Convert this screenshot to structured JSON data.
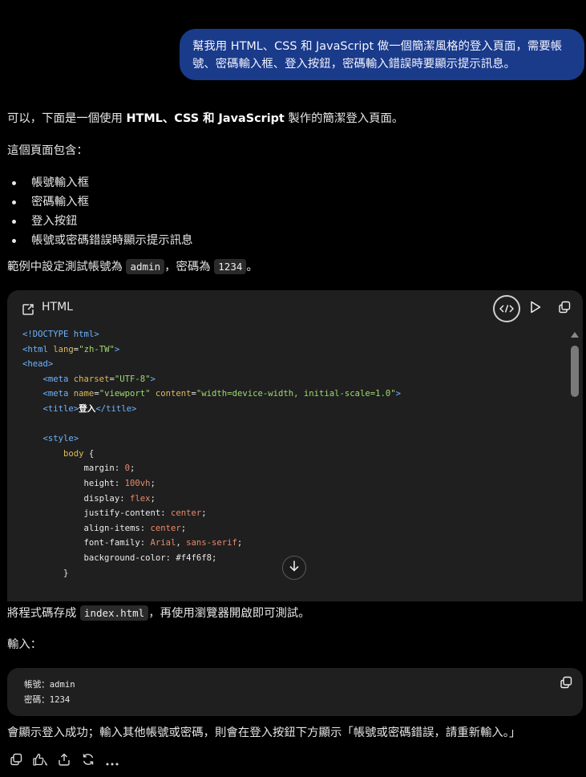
{
  "user_message": "幫我用 HTML、CSS 和 JavaScript 做一個簡潔風格的登入頁面，需要帳號、密碼輸入框、登入按鈕，密碼輸入錯誤時要顯示提示訊息。",
  "response": {
    "intro_prefix": "可以，下面是一個使用 ",
    "intro_bold": "HTML、CSS 和 JavaScript",
    "intro_suffix": " 製作的簡潔登入頁面。",
    "contains_label": "這個頁面包含：",
    "bullets": [
      "帳號輸入框",
      "密碼輸入框",
      "登入按鈕",
      "帳號或密碼錯誤時顯示提示訊息"
    ],
    "test_prefix": "範例中設定測試帳號為 ",
    "test_account": "admin",
    "test_mid": "，密碼為 ",
    "test_password": "1234",
    "test_suffix": "。",
    "save_prefix": "將程式碼存成 ",
    "save_file": "index.html",
    "save_suffix": "，再使用瀏覽器開啟即可測試。",
    "input_label": "輸入：",
    "input_account_label": "帳號：",
    "input_account": "admin",
    "input_password_label": "密碼：",
    "input_password": "1234",
    "result_text": "會顯示登入成功；輸入其他帳號或密碼，則會在登入按鈕下方顯示「帳號或密碼錯誤，請重新輸入。」"
  },
  "code_block": {
    "language": "HTML",
    "icons": {
      "lang": "edit-code-icon",
      "preview": "code-preview-icon",
      "run": "play-icon",
      "copy": "copy-icon",
      "scroll_down": "arrow-down-icon"
    },
    "lines": [
      [
        {
          "t": "tag",
          "v": "<!DOCTYPE html>"
        }
      ],
      [
        {
          "t": "tag",
          "v": "<html "
        },
        {
          "t": "attr",
          "v": "lang"
        },
        {
          "t": "plain",
          "v": "="
        },
        {
          "t": "str",
          "v": "\"zh-TW\""
        },
        {
          "t": "tag",
          "v": ">"
        }
      ],
      [
        {
          "t": "tag",
          "v": "<head>"
        }
      ],
      [
        {
          "t": "plain",
          "v": "    "
        },
        {
          "t": "tag",
          "v": "<meta "
        },
        {
          "t": "attr",
          "v": "charset"
        },
        {
          "t": "plain",
          "v": "="
        },
        {
          "t": "str",
          "v": "\"UTF-8\""
        },
        {
          "t": "tag",
          "v": ">"
        }
      ],
      [
        {
          "t": "plain",
          "v": "    "
        },
        {
          "t": "tag",
          "v": "<meta "
        },
        {
          "t": "attr",
          "v": "name"
        },
        {
          "t": "plain",
          "v": "="
        },
        {
          "t": "str",
          "v": "\"viewport\""
        },
        {
          "t": "plain",
          "v": " "
        },
        {
          "t": "attr",
          "v": "content"
        },
        {
          "t": "plain",
          "v": "="
        },
        {
          "t": "str",
          "v": "\"width=device-width, initial-scale=1.0\""
        },
        {
          "t": "tag",
          "v": ">"
        }
      ],
      [
        {
          "t": "plain",
          "v": "    "
        },
        {
          "t": "tag",
          "v": "<title>"
        },
        {
          "t": "txt",
          "v": "登入"
        },
        {
          "t": "tag",
          "v": "</title>"
        }
      ],
      [
        {
          "t": "plain",
          "v": ""
        }
      ],
      [
        {
          "t": "plain",
          "v": "    "
        },
        {
          "t": "tag",
          "v": "<style>"
        }
      ],
      [
        {
          "t": "plain",
          "v": "        "
        },
        {
          "t": "attr",
          "v": "body"
        },
        {
          "t": "plain",
          "v": " {"
        }
      ],
      [
        {
          "t": "plain",
          "v": "            "
        },
        {
          "t": "prop",
          "v": "margin"
        },
        {
          "t": "plain",
          "v": ": "
        },
        {
          "t": "val",
          "v": "0"
        },
        {
          "t": "plain",
          "v": ";"
        }
      ],
      [
        {
          "t": "plain",
          "v": "            "
        },
        {
          "t": "prop",
          "v": "height"
        },
        {
          "t": "plain",
          "v": ": "
        },
        {
          "t": "val",
          "v": "100vh"
        },
        {
          "t": "plain",
          "v": ";"
        }
      ],
      [
        {
          "t": "plain",
          "v": "            "
        },
        {
          "t": "prop",
          "v": "display"
        },
        {
          "t": "plain",
          "v": ": "
        },
        {
          "t": "val",
          "v": "flex"
        },
        {
          "t": "plain",
          "v": ";"
        }
      ],
      [
        {
          "t": "plain",
          "v": "            "
        },
        {
          "t": "prop",
          "v": "justify-content"
        },
        {
          "t": "plain",
          "v": ": "
        },
        {
          "t": "val",
          "v": "center"
        },
        {
          "t": "plain",
          "v": ";"
        }
      ],
      [
        {
          "t": "plain",
          "v": "            "
        },
        {
          "t": "prop",
          "v": "align-items"
        },
        {
          "t": "plain",
          "v": ": "
        },
        {
          "t": "val",
          "v": "center"
        },
        {
          "t": "plain",
          "v": ";"
        }
      ],
      [
        {
          "t": "plain",
          "v": "            "
        },
        {
          "t": "prop",
          "v": "font-family"
        },
        {
          "t": "plain",
          "v": ": "
        },
        {
          "t": "val",
          "v": "Arial"
        },
        {
          "t": "plain",
          "v": ", "
        },
        {
          "t": "val",
          "v": "sans-serif"
        },
        {
          "t": "plain",
          "v": ";"
        }
      ],
      [
        {
          "t": "plain",
          "v": "            "
        },
        {
          "t": "prop",
          "v": "background-color"
        },
        {
          "t": "plain",
          "v": ": #f4f6f8;"
        }
      ],
      [
        {
          "t": "plain",
          "v": "        }"
        }
      ]
    ]
  },
  "action_icons": [
    "copy-icon",
    "thumbs-up-icon",
    "thumbs-down-icon",
    "share-icon",
    "regenerate-icon",
    "more-icon"
  ],
  "colors": {
    "background": "#000000",
    "user_bubble": "#1a3a8a",
    "code_card": "#1f1f1f",
    "tag": "#6fb3ff",
    "attr": "#e0b85a",
    "string": "#9fd96f",
    "value": "#e88a6b"
  }
}
